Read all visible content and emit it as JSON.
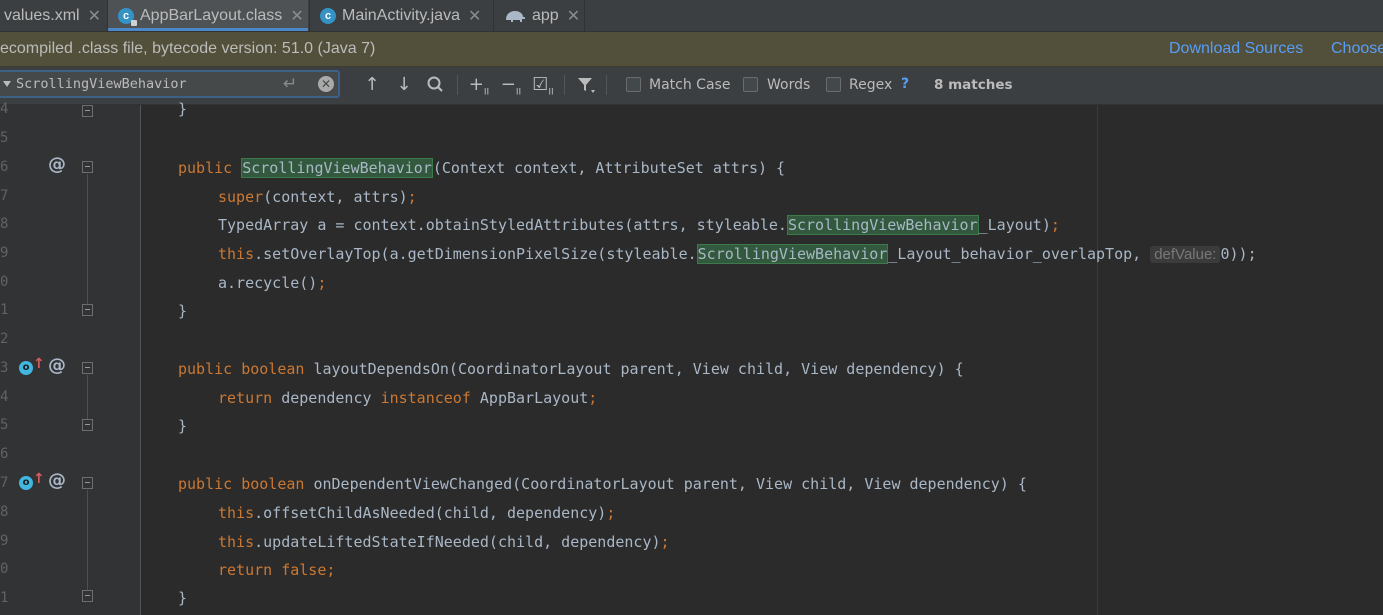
{
  "tabs": [
    {
      "label": "values.xml",
      "icon": "xml-file-icon"
    },
    {
      "label": "AppBarLayout.class",
      "icon": "class-file-icon",
      "active": true
    },
    {
      "label": "MainActivity.java",
      "icon": "class-file-icon"
    },
    {
      "label": "app",
      "icon": "gradle-elephant-icon"
    }
  ],
  "banner": {
    "message": "ecompiled .class file, bytecode version: 51.0 (Java 7)",
    "download_sources": "Download Sources",
    "choose_sources": "Choose"
  },
  "search": {
    "query": "ScrollingViewBehavior",
    "match_case": "Match Case",
    "words": "Words",
    "regex": "Regex",
    "help": "?",
    "matches": "8 matches",
    "help_mark": "?"
  },
  "line_numbers": [
    "4",
    "5",
    "6",
    "7",
    "8",
    "9",
    "0",
    "1",
    "2",
    "3",
    "4",
    "5",
    "6",
    "7",
    "8",
    "9",
    "0",
    "1"
  ],
  "code": {
    "l4": {
      "brace": "}"
    },
    "l6": {
      "kw": "public",
      "hl": "ScrollingViewBehavior",
      "rest": "(Context context, AttributeSet attrs) {"
    },
    "l7": {
      "kw": "super",
      "rest": "(context, attrs)",
      "semi": ";"
    },
    "l8": {
      "pre": "TypedArray a = context.obtainStyledAttributes(attrs, styleable.",
      "hl": "ScrollingViewBehavior",
      "post": "_Layout)",
      "semi": ";"
    },
    "l9": {
      "kw": "this",
      "pre": ".setOverlayTop(a.getDimensionPixelSize(styleable.",
      "hl": "ScrollingViewBehavior",
      "post": "_Layout_behavior_overlapTop, ",
      "hint": "defValue:",
      "end": "0));"
    },
    "l10": {
      "pre": "a.recycle()",
      "semi": ";"
    },
    "l11": {
      "brace": "}"
    },
    "l13": {
      "kw1": "public",
      "kw2": "boolean",
      "rest": "layoutDependsOn(CoordinatorLayout parent, View child, View dependency) {"
    },
    "l14": {
      "kw": "return",
      "mid": "dependency",
      "kw2": "instanceof",
      "rest": "AppBarLayout",
      "semi": ";"
    },
    "l15": {
      "brace": "}"
    },
    "l17": {
      "kw1": "public",
      "kw2": "boolean",
      "rest": "onDependentViewChanged(CoordinatorLayout parent, View child, View dependency) {"
    },
    "l18": {
      "kw": "this",
      "rest": ".offsetChildAsNeeded(child, dependency)",
      "semi": ";"
    },
    "l19": {
      "kw": "this",
      "rest": ".updateLiftedStateIfNeeded(child, dependency)",
      "semi": ";"
    },
    "l20": {
      "kw": "return",
      "kw2": "false",
      "semi": ";"
    },
    "l21": {
      "brace": "}"
    }
  },
  "gutter_marks": {
    "at": "@",
    "override": "o",
    "arrow": "↑"
  },
  "colors": {
    "keyword": "#cc7832",
    "text": "#a9b7c6",
    "highlight": "#32593d",
    "link": "#589df6",
    "banner": "#52503a"
  }
}
